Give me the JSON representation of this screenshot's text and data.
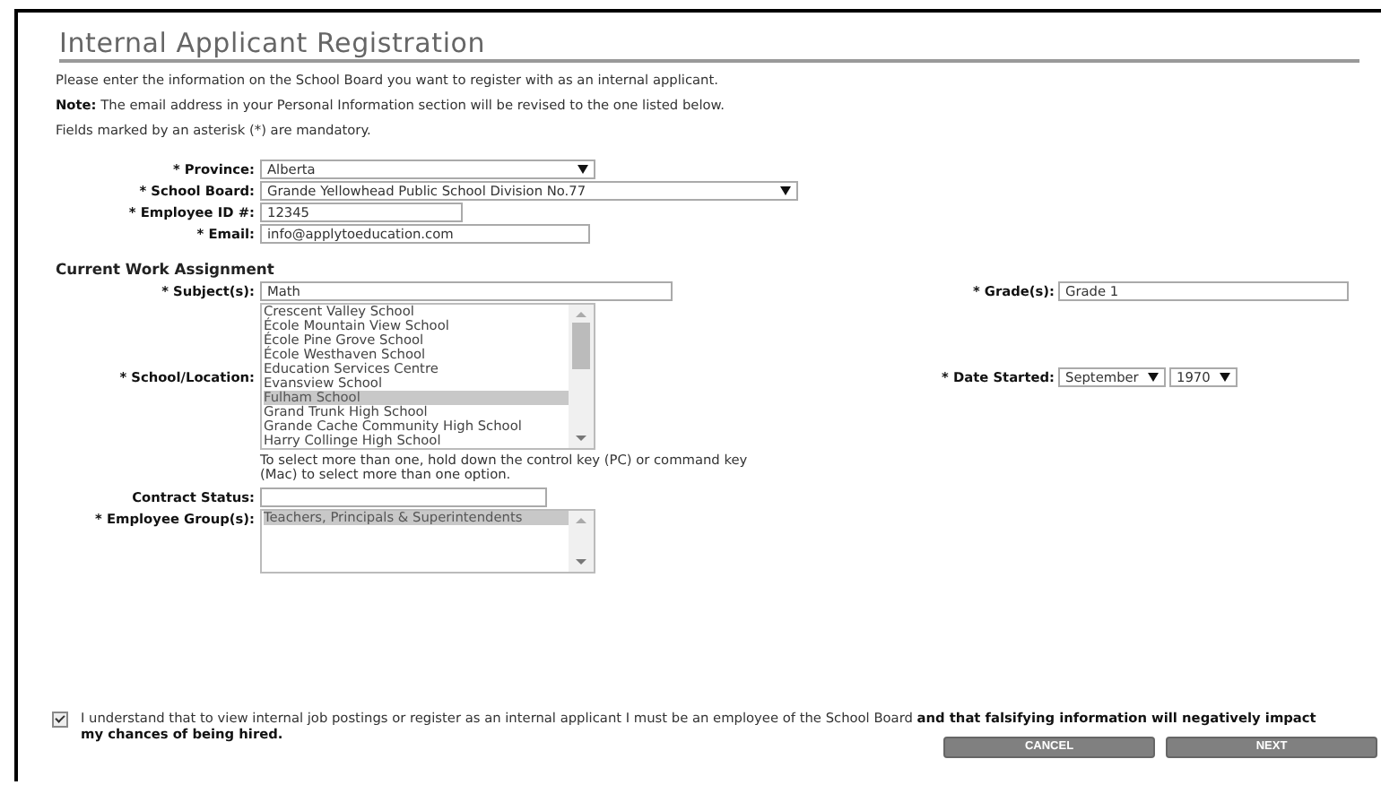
{
  "title": "Internal Applicant Registration",
  "intro": [
    "Please enter the information on the School Board you want to register with as an internal applicant.",
    "**Note:** The email address in your Personal Information section will be revised to the one listed below.",
    "Fields marked by an asterisk (*) are mandatory."
  ],
  "rows": [
    {
      "label": "* Province:",
      "control": {
        "kind": "select",
        "value": "Alberta"
      }
    },
    {
      "label": "* School Board:",
      "control": {
        "kind": "select",
        "value": "Grande Yellowhead Public School Division No.77"
      }
    },
    {
      "label": "* Employee ID #:",
      "control": {
        "kind": "text",
        "value": "12345"
      }
    },
    {
      "label": "* Email:",
      "control": {
        "kind": "text",
        "value": "info@applytoeducation.com"
      }
    },
    {
      "kind": "heading",
      "label": "Current Work Assignment"
    },
    {
      "label": "* Subject(s):",
      "control": {
        "kind": "text",
        "value": "Math"
      },
      "side": {
        "label": "* Grade(s):",
        "controls": [
          {
            "kind": "text",
            "value": "Grade 1"
          }
        ]
      }
    },
    {
      "label": "* School/Location:",
      "control": {
        "kind": "listbox",
        "options": [
          {
            "text": "Crescent Valley School",
            "selected": false
          },
          {
            "text": "École Mountain View School",
            "selected": false
          },
          {
            "text": "École Pine Grove School",
            "selected": false
          },
          {
            "text": "École Westhaven School",
            "selected": false
          },
          {
            "text": "Education Services Centre",
            "selected": false
          },
          {
            "text": "Evansview School",
            "selected": false
          },
          {
            "text": "Fulham School",
            "selected": true
          },
          {
            "text": "Grand Trunk High School",
            "selected": false
          },
          {
            "text": "Grande Cache Community High School",
            "selected": false
          },
          {
            "text": "Harry Collinge High School",
            "selected": false
          }
        ],
        "hint": "To select more than one, hold down the control key (PC) or command key (Mac) to select more than one option."
      },
      "side": {
        "label": "* Date Started:",
        "controls": [
          {
            "kind": "select",
            "value": "September"
          },
          {
            "kind": "select",
            "value": "1970"
          }
        ]
      }
    },
    {
      "label": "Contract Status:",
      "control": {
        "kind": "text"
      }
    },
    {
      "label": "* Employee Group(s):",
      "control": {
        "kind": "listbox",
        "options": [
          {
            "text": "Teachers, Principals & Superintendents",
            "selected": true
          }
        ]
      }
    }
  ],
  "agreement": {
    "checked": true,
    "text": "I understand that to view internal job postings or register as an internal applicant I must be an employee of the School Board **and that falsifying information will negatively impact my chances of being hired.**"
  },
  "buttons": [
    "CANCEL",
    "NEXT"
  ]
}
